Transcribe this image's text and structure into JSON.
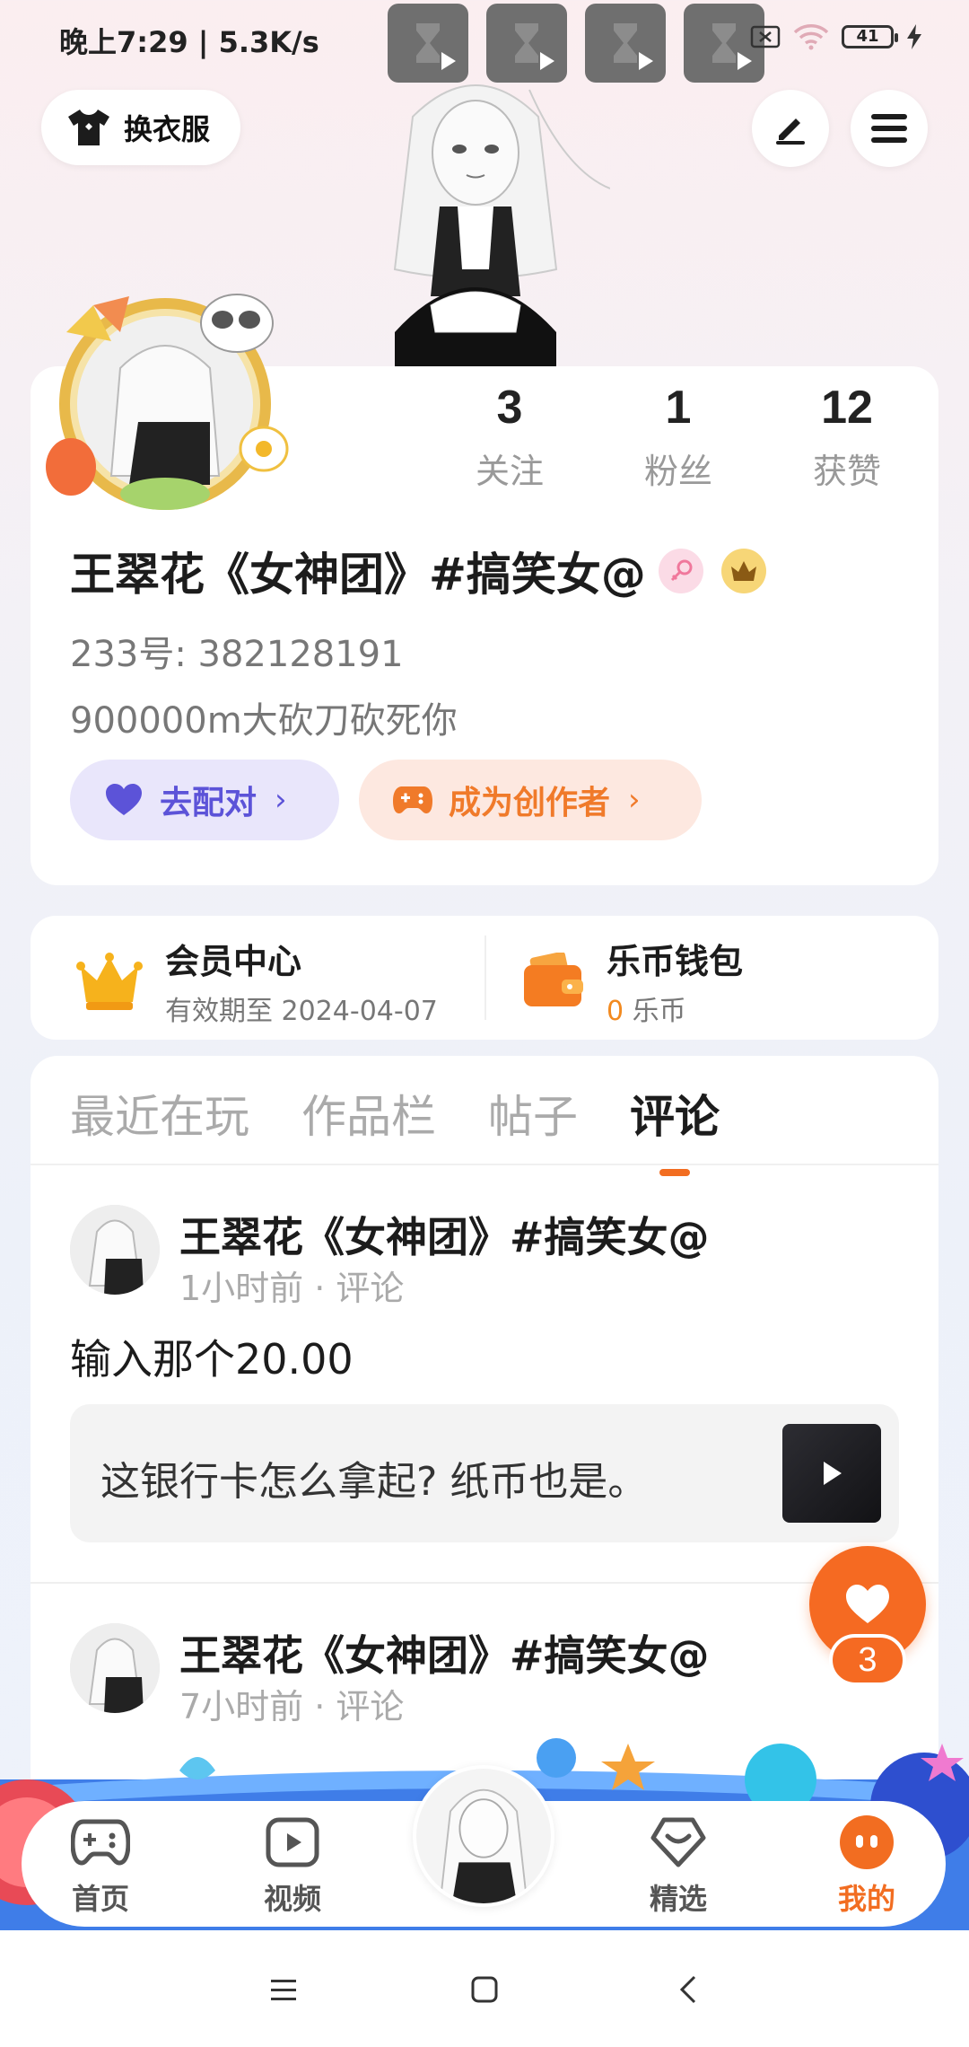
{
  "status_bar": {
    "time": "晚上7:29 | 5.3K/s",
    "battery": "41"
  },
  "header": {
    "dress_label": "换衣服"
  },
  "profile": {
    "stats": [
      {
        "num": "3",
        "label": "关注"
      },
      {
        "num": "1",
        "label": "粉丝"
      },
      {
        "num": "12",
        "label": "获赞"
      }
    ],
    "username": "王翠花《女神团》#搞笑女@",
    "user_id": "233号: 382128191",
    "bio": "900000m大砍刀砍死你",
    "match_label": "去配对",
    "creator_label": "成为创作者"
  },
  "member": {
    "title": "会员中心",
    "expiry": "有效期至 2024-04-07",
    "wallet_title": "乐币钱包",
    "wallet_amount": "0",
    "wallet_unit": "乐币"
  },
  "tabs": [
    "最近在玩",
    "作品栏",
    "帖子",
    "评论"
  ],
  "active_tab": "评论",
  "posts": [
    {
      "name": "王翠花《女神团》#搞笑女@",
      "meta": "1小时前 · 评论",
      "text": "输入那个20.00",
      "quote": "这银行卡怎么拿起? 纸币也是。"
    },
    {
      "name": "王翠花《女神团》#搞笑女@",
      "meta": "7小时前 · 评论"
    }
  ],
  "like_count": "3",
  "bottom_nav": [
    {
      "label": "首页",
      "icon": "gamepad-icon"
    },
    {
      "label": "视频",
      "icon": "video-icon"
    },
    {
      "label": "精选",
      "icon": "heart-diamond-icon"
    },
    {
      "label": "我的",
      "icon": "profile-face-icon"
    }
  ],
  "colors": {
    "accent": "#f26d21",
    "match_purple": "#5c53d8",
    "creator_orange": "#f07a2a"
  }
}
